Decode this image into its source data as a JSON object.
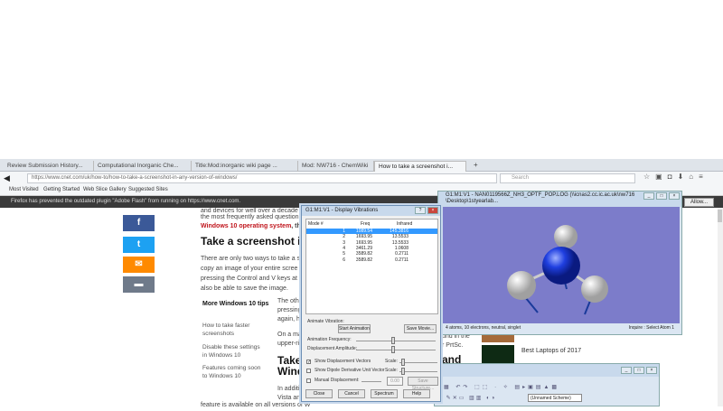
{
  "browser": {
    "tabs": [
      "Review Submission History...",
      "Computational Inorganic Che...",
      "Title:Mod:inorganic wiki page ...",
      "Mod: NW716 - ChemWiki",
      "How to take a screenshot i..."
    ],
    "url": "https://www.cnet.com/uk/how-to/how-to-take-a-screenshot-in-any-version-of-windows/",
    "search_placeholder": "Search",
    "bookmarks": [
      "Most Visited",
      "Getting Started",
      "Web Slice Gallery",
      "Suggested Sites"
    ],
    "notification": "Firefox has prevented the outdated plugin \"Adobe Flash\" from running on https://www.cnet.com.",
    "allow": "Allow..."
  },
  "article": {
    "line0": "and devices for well over a decade",
    "line1": "the most frequently asked question",
    "link": "Windows 10 operating system",
    "link_tail": ", the",
    "heading1": "Take a screenshot in W",
    "para": [
      "There are only two ways to take a s",
      "copy an image of your entire scree",
      "pressing the Control and V keys at",
      "also be able to save the image."
    ],
    "sidebar_title": "More Windows 10 tips",
    "sidebar_links": [
      "How to take faster screenshots",
      "Disable these settings in Windows 10",
      "Features coming soon to Windows 10"
    ],
    "para2": [
      "The oth",
      "pressing",
      "again, h"
    ],
    "para3": [
      "On a ma",
      "upper-ri"
    ],
    "heading2a": "Take",
    "heading2b": "Wind",
    "para4": [
      "In additi",
      "Vista an"
    ],
    "last": "feature is available on all versions of W",
    "right_text": [
      "und in the",
      "r PrtSc.",
      "and"
    ],
    "promo": "Best Laptops of 2017"
  },
  "vib_dialog": {
    "title": "G1:M1:V1 - Display Vibrations",
    "columns": [
      "Mode #",
      "Freq",
      "Infrared"
    ],
    "rows": [
      [
        "1",
        "1089.54",
        "145.3816"
      ],
      [
        "2",
        "1693.95",
        "13.5533"
      ],
      [
        "3",
        "1693.95",
        "13.5533"
      ],
      [
        "4",
        "3461.29",
        "1.0608"
      ],
      [
        "5",
        "3589.82",
        "0.2711"
      ],
      [
        "6",
        "3589.82",
        "0.2711"
      ]
    ],
    "animate_label": "Animate Vibration:",
    "start": "Start Animation",
    "save_movie": "Save Movie...",
    "freq": "Animation Frequency:",
    "amp": "Displacement Amplitude:",
    "show_disp": "Show Displacement Vectors",
    "show_dipole": "Show Dipole Derivative Unit Vector",
    "scale": "Scale:",
    "manual": "Manual Displacement:",
    "manual_val": "0.00",
    "save_struct": "Save Structure...",
    "buttons": [
      "Close",
      "Cancel",
      "Spectrum",
      "Help"
    ]
  },
  "mol_window": {
    "title": "G1:M1:V1 - NAN0119566Z_NH3_OPTF_POP.LOG (\\\\icnas2.cc.ic.ac.uk\\nw716\\Desktop\\1styearlab...",
    "status_left": "4 atoms, 10 electrons, neutral, singlet",
    "status_right": "Inquire : Select Atom 1"
  },
  "gv_main": {
    "scheme": "(Unnamed Scheme)"
  },
  "colors": {
    "molecule_bg": "#7c7cca",
    "nitrogen": "#1f3fe0",
    "hydrogen": "#f2f2f2",
    "facebook": "#3b5998",
    "twitter": "#1da1f2",
    "email": "#ff8a00",
    "comment": "#6f7a8a"
  }
}
